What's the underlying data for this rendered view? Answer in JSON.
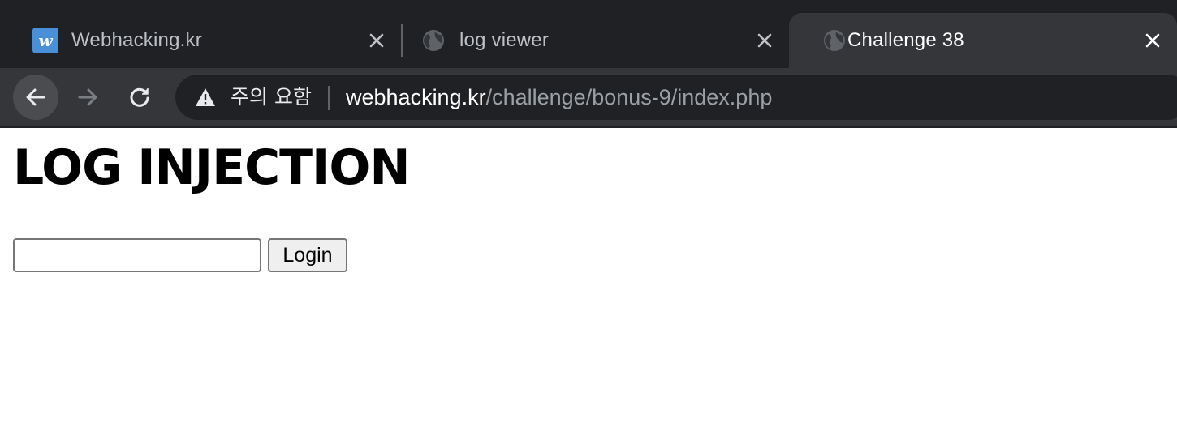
{
  "tabs": [
    {
      "title": "Webhacking.kr",
      "favicon": "webhacking-w-icon",
      "favicon_letter": "w",
      "active": false
    },
    {
      "title": "log viewer",
      "favicon": "globe-icon",
      "active": false
    },
    {
      "title": "Challenge 38",
      "favicon": "globe-icon",
      "active": true
    }
  ],
  "toolbar": {
    "security_label": "주의 요함",
    "url_host": "webhacking.kr",
    "url_path": "/challenge/bonus-9/index.php"
  },
  "page": {
    "heading": "LOG INJECTION",
    "input_value": "",
    "login_label": "Login"
  },
  "colors": {
    "tabstrip_bg": "#202124",
    "toolbar_bg": "#35363a",
    "favicon_blue": "#4a90d9"
  }
}
